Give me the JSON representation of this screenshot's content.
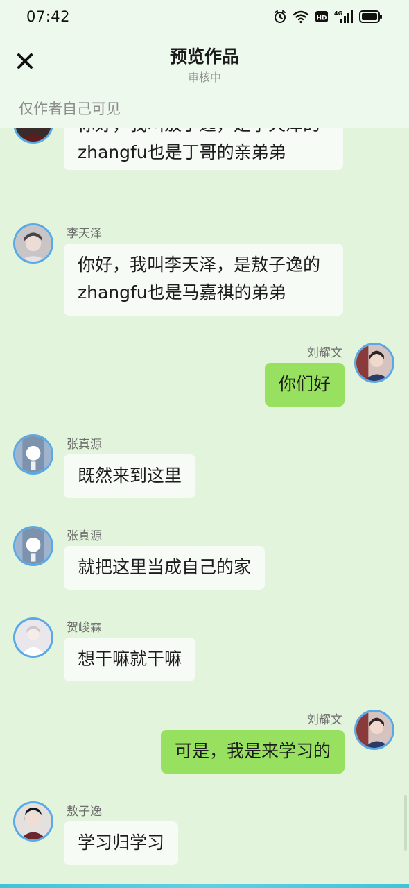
{
  "status_bar": {
    "time": "07:42",
    "icons": [
      "alarm-icon",
      "wifi-icon",
      "hd-icon",
      "4g-signal-icon",
      "battery-icon"
    ],
    "hd_label": "HD",
    "network_label": "4G"
  },
  "header": {
    "close_icon": "close-icon",
    "title": "预览作品",
    "subtitle": "审核中",
    "visibility_note": "仅作者自己可见"
  },
  "messages": [
    {
      "side": "left",
      "name": "",
      "text": "你好，我叫敖子逸，是李天泽的zhangfu也是丁哥的亲弟弟"
    },
    {
      "side": "left",
      "name": "李天泽",
      "text": "你好，我叫李天泽，是敖子逸的zhangfu也是马嘉祺的弟弟"
    },
    {
      "side": "right",
      "name": "刘耀文",
      "text": "你们好"
    },
    {
      "side": "left",
      "name": "张真源",
      "text": "既然来到这里"
    },
    {
      "side": "left",
      "name": "张真源",
      "text": "就把这里当成自己的家"
    },
    {
      "side": "left",
      "name": "贺峻霖",
      "text": "想干嘛就干嘛"
    },
    {
      "side": "right",
      "name": "刘耀文",
      "text": "可是，我是来学习的"
    },
    {
      "side": "left",
      "name": "敖子逸",
      "text": "学习归学习"
    }
  ],
  "colors": {
    "background": "#e3f4dc",
    "header_background": "#eef9ee",
    "incoming_bubble": "#f7fbf6",
    "outgoing_bubble": "#98e05f",
    "avatar_ring": "#5aa9e6"
  }
}
